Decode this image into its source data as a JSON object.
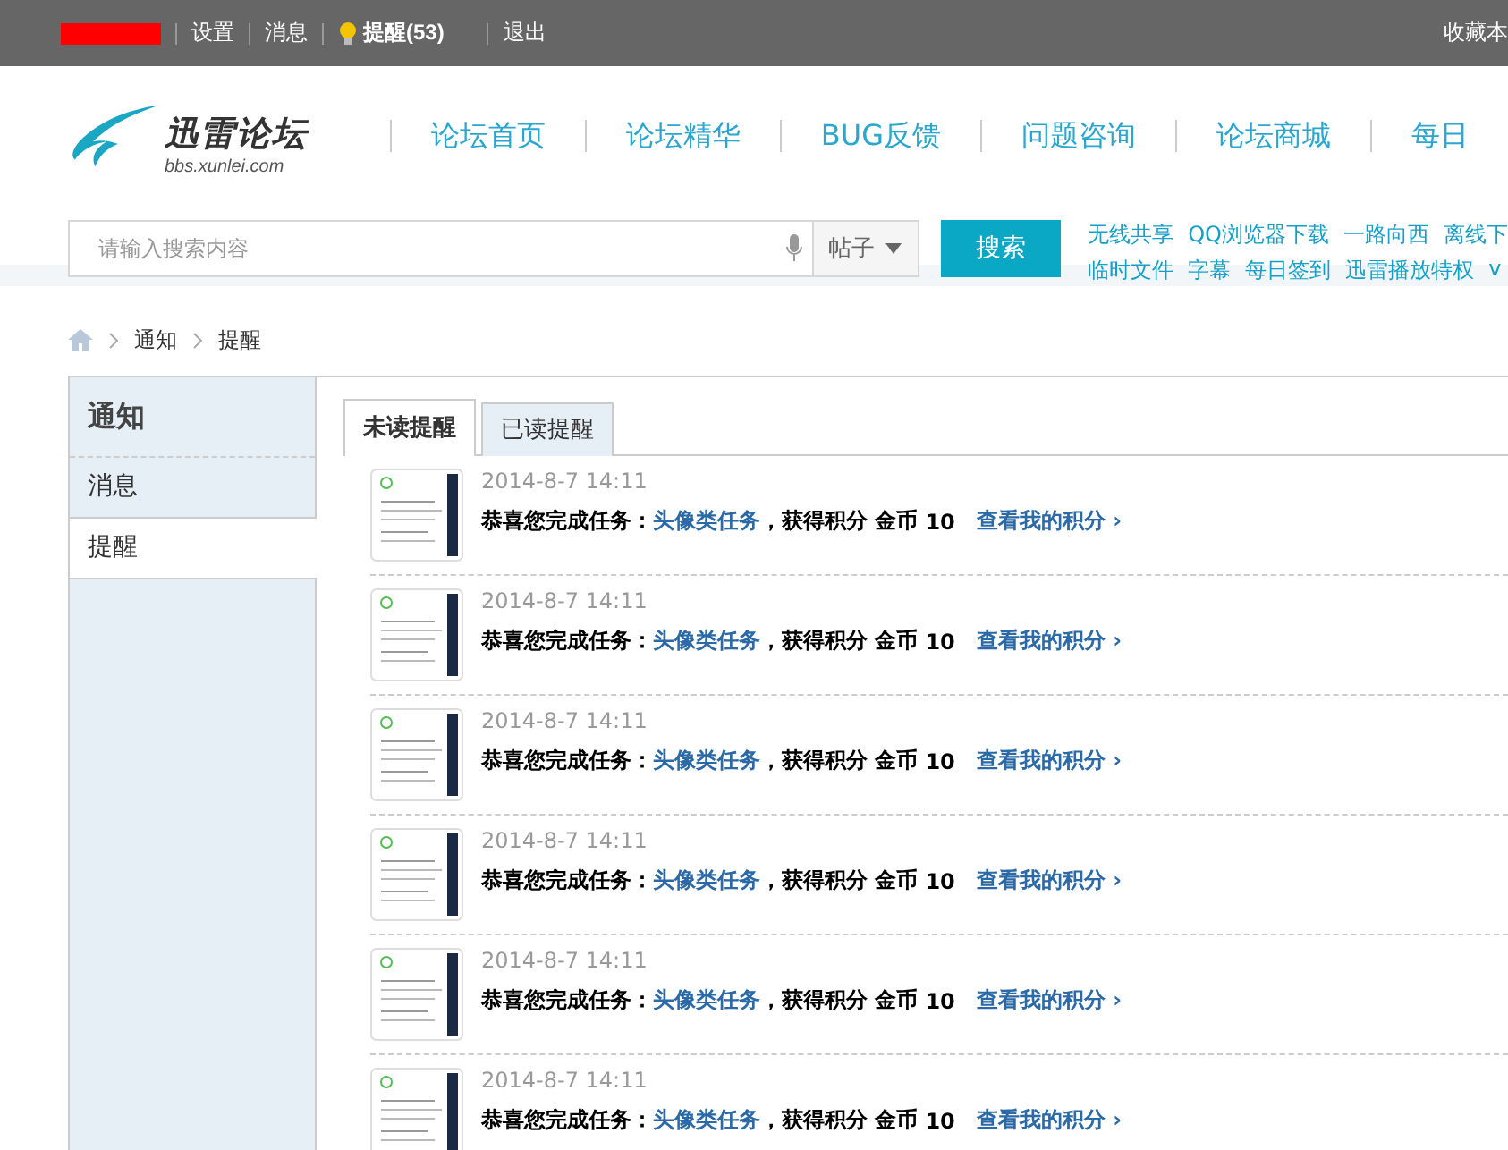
{
  "top_bar": {
    "links": [
      {
        "label": "设置",
        "kind": "plain"
      },
      {
        "label": "消息",
        "kind": "plain"
      },
      {
        "label": "提醒(53)",
        "kind": "alert"
      },
      {
        "label": "退出",
        "kind": "plain"
      }
    ],
    "right_link": "收藏本"
  },
  "logo": {
    "title": "迅雷论坛",
    "subtitle": "bbs.xunlei.com"
  },
  "nav": [
    "论坛首页",
    "论坛精华",
    "BUG反馈",
    "问题咨询",
    "论坛商城",
    "每日"
  ],
  "search": {
    "placeholder": "请输入搜索内容",
    "scope": "帖子",
    "button": "搜索"
  },
  "quick_links": [
    [
      "无线共享",
      "QQ浏览器下载",
      "一路向西",
      "离线下"
    ],
    [
      "临时文件",
      "字幕",
      "每日签到",
      "迅雷播放特权",
      "v"
    ]
  ],
  "breadcrumb": [
    "通知",
    "提醒"
  ],
  "sidebar": {
    "title": "通知",
    "items": [
      {
        "label": "消息",
        "selected": false
      },
      {
        "label": "提醒",
        "selected": true
      }
    ]
  },
  "tabs": [
    {
      "label": "未读提醒",
      "selected": true
    },
    {
      "label": "已读提醒",
      "selected": false
    }
  ],
  "notices": [
    {
      "time": "2014-8-7 14:11",
      "prefix": "恭喜您完成任务：",
      "task": "头像类任务",
      "middle": "，获得积分 金币",
      "amount": "10",
      "link": "查看我的积分 ›"
    },
    {
      "time": "2014-8-7 14:11",
      "prefix": "恭喜您完成任务：",
      "task": "头像类任务",
      "middle": "，获得积分 金币",
      "amount": "10",
      "link": "查看我的积分 ›"
    },
    {
      "time": "2014-8-7 14:11",
      "prefix": "恭喜您完成任务：",
      "task": "头像类任务",
      "middle": "，获得积分 金币",
      "amount": "10",
      "link": "查看我的积分 ›"
    },
    {
      "time": "2014-8-7 14:11",
      "prefix": "恭喜您完成任务：",
      "task": "头像类任务",
      "middle": "，获得积分 金币",
      "amount": "10",
      "link": "查看我的积分 ›"
    },
    {
      "time": "2014-8-7 14:11",
      "prefix": "恭喜您完成任务：",
      "task": "头像类任务",
      "middle": "，获得积分 金币",
      "amount": "10",
      "link": "查看我的积分 ›"
    },
    {
      "time": "2014-8-7 14:11",
      "prefix": "恭喜您完成任务：",
      "task": "头像类任务",
      "middle": "，获得积分 金币",
      "amount": "10",
      "link": "查看我的积分 ›"
    }
  ]
}
